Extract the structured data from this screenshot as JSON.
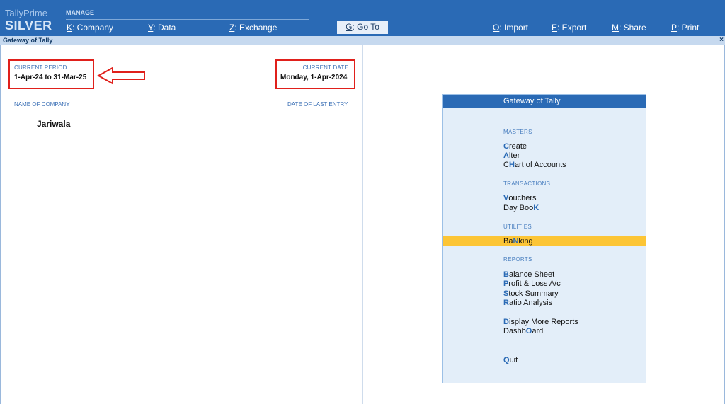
{
  "app": {
    "brand_top": "TallyPrime",
    "brand_edition": "SILVER"
  },
  "topbar": {
    "section_label": "MANAGE",
    "menu": [
      {
        "key": "K",
        "label": ": Company"
      },
      {
        "key": "Y",
        "label": ": Data"
      },
      {
        "key": "Z",
        "label": ": Exchange"
      },
      {
        "key": "G",
        "label": ": Go To"
      },
      {
        "key": "O",
        "label": ": Import"
      },
      {
        "key": "E",
        "label": ": Export"
      },
      {
        "key": "M",
        "label": ": Share"
      },
      {
        "key": "P",
        "label": ": Print"
      }
    ]
  },
  "window": {
    "title": "Gateway of Tally",
    "close_glyph": "×"
  },
  "left_panel": {
    "current_period_label": "CURRENT PERIOD",
    "current_period_value": "1-Apr-24 to 31-Mar-25",
    "current_date_label": "CURRENT DATE",
    "current_date_value": "Monday, 1-Apr-2024",
    "col_company": "NAME OF COMPANY",
    "col_last_entry": "DATE OF LAST ENTRY",
    "companies": [
      "Jariwala"
    ]
  },
  "gateway": {
    "title": "Gateway of Tally",
    "masters_label": "MASTERS",
    "transactions_label": "TRANSACTIONS",
    "utilities_label": "UTILITIES",
    "reports_label": "REPORTS",
    "items": {
      "create": {
        "pre": "",
        "key": "C",
        "post": "reate"
      },
      "alter": {
        "pre": "",
        "key": "A",
        "post": "lter"
      },
      "chart": {
        "pre": "C",
        "key": "H",
        "post": "art of Accounts"
      },
      "vouchers": {
        "pre": "",
        "key": "V",
        "post": "ouchers"
      },
      "daybook": {
        "pre": "Day Boo",
        "key": "K",
        "post": ""
      },
      "banking": {
        "pre": "Ba",
        "key": "N",
        "post": "king"
      },
      "balance": {
        "pre": "",
        "key": "B",
        "post": "alance Sheet"
      },
      "profit": {
        "pre": "",
        "key": "P",
        "post": "rofit & Loss A/c"
      },
      "stock": {
        "pre": "",
        "key": "S",
        "post": "tock Summary"
      },
      "ratio": {
        "pre": "",
        "key": "R",
        "post": "atio Analysis"
      },
      "display_more": {
        "pre": "",
        "key": "D",
        "post": "isplay More Reports"
      },
      "dashboard": {
        "pre": "Dashb",
        "key": "O",
        "post": "ard"
      },
      "quit": {
        "pre": "",
        "key": "Q",
        "post": "uit"
      }
    },
    "highlight_color": "#fcc536"
  },
  "colors": {
    "brand_blue": "#2a6ab5",
    "annotation_red": "#e0201b"
  }
}
